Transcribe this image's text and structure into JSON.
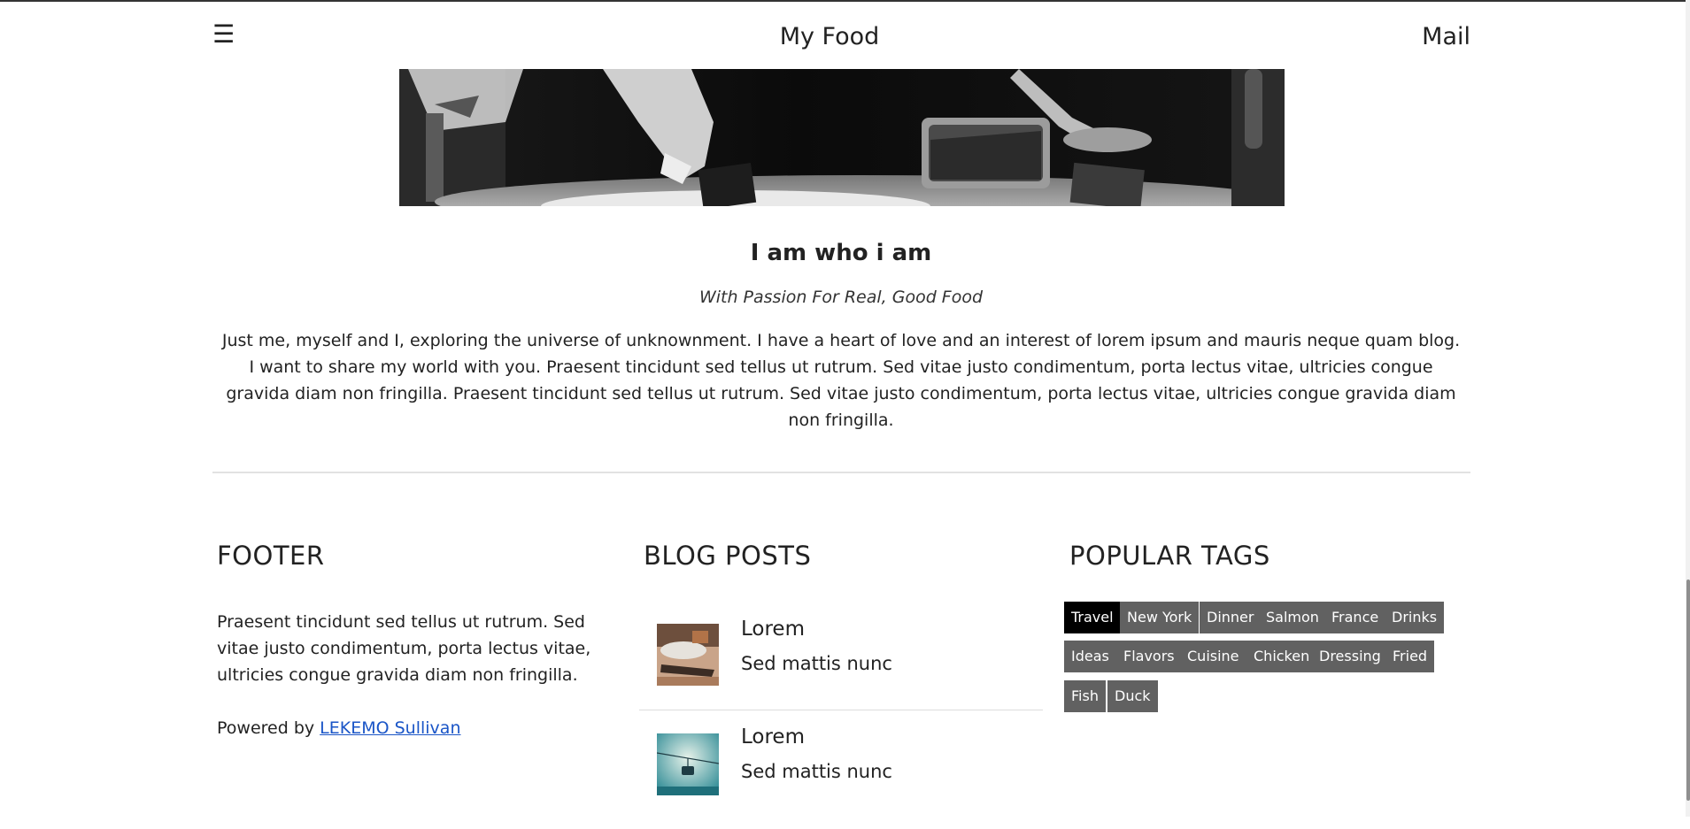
{
  "nav": {
    "menu_icon": "☰",
    "title": "My Food",
    "mail": "Mail"
  },
  "hero": {
    "alt": ""
  },
  "about": {
    "heading": "I am who i am",
    "tagline": "With Passion For Real, Good Food",
    "bio": "Just me, myself and I, exploring the universe of unknownment. I have a heart of love and an interest of lorem ipsum and mauris neque quam blog. I want to share my world with you. Praesent tincidunt sed tellus ut rutrum. Sed vitae justo condimentum, porta lectus vitae, ultricies congue gravida diam non fringilla. Praesent tincidunt sed tellus ut rutrum. Sed vitae justo condimentum, porta lectus vitae, ultricies congue gravida diam non fringilla."
  },
  "footer": {
    "title": "FOOTER",
    "text": "Praesent tincidunt sed tellus ut rutrum. Sed vitae justo condimentum, porta lectus vitae, ultricies congue gravida diam non fringilla.",
    "powered_prefix": "Powered by ",
    "powered_link": "LEKEMO Sullivan"
  },
  "blog": {
    "title": "BLOG POSTS",
    "posts": [
      {
        "title": "Lorem",
        "subtitle": "Sed mattis nunc"
      },
      {
        "title": "Lorem",
        "subtitle": "Sed mattis nunc"
      }
    ]
  },
  "tags": {
    "title": "POPULAR TAGS",
    "items": [
      "Travel",
      "New York",
      "Dinner",
      "Salmon",
      "France",
      "Drinks",
      "Ideas",
      "Flavors",
      "Cuisine",
      "Chicken",
      "Dressing",
      "Fried",
      "Fish",
      "Duck"
    ],
    "active": "Travel"
  },
  "colors": {
    "tag_bg": "#616161",
    "tag_active_bg": "#000000",
    "link": "#1a55c7"
  }
}
